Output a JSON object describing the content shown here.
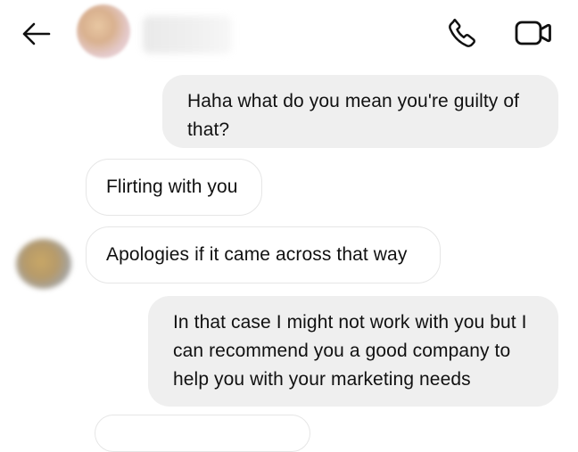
{
  "header": {
    "contact_name": "",
    "icons": {
      "back": "arrow-left-icon",
      "call": "phone-icon",
      "video": "video-camera-icon"
    }
  },
  "messages": [
    {
      "direction": "outgoing",
      "text": "Haha what do you mean you're guilty of that?"
    },
    {
      "direction": "incoming",
      "text": "Flirting with you"
    },
    {
      "direction": "incoming",
      "text": "Apologies if it came across that way"
    },
    {
      "direction": "outgoing",
      "text": "In that case I might not work with you but I can recommend you a good company to help you with your marketing needs"
    }
  ],
  "colors": {
    "background": "#ffffff",
    "outgoing_bubble": "#efefef",
    "incoming_border": "#e6e6e6",
    "text": "#111111",
    "icon": "#111111"
  }
}
